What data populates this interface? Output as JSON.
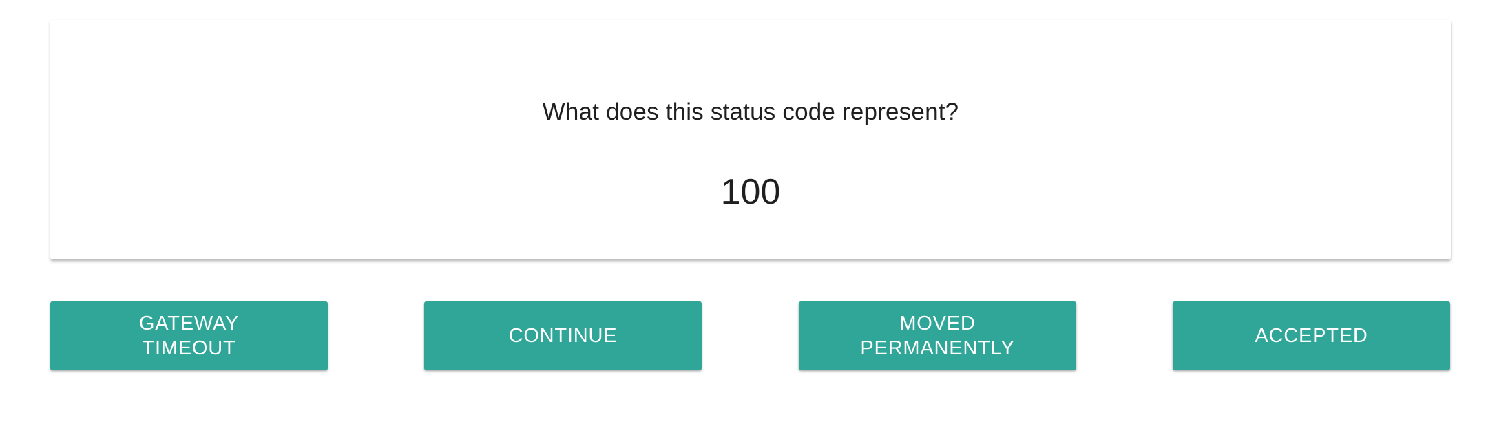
{
  "quiz": {
    "question": "What does this status code represent?",
    "status_code": "100"
  },
  "answers": [
    {
      "label": "GATEWAY TIMEOUT"
    },
    {
      "label": "CONTINUE"
    },
    {
      "label": "MOVED PERMANENTLY"
    },
    {
      "label": "ACCEPTED"
    }
  ],
  "colors": {
    "button_background": "#30a699",
    "button_text": "#ffffff",
    "text": "#1f1f1f"
  }
}
